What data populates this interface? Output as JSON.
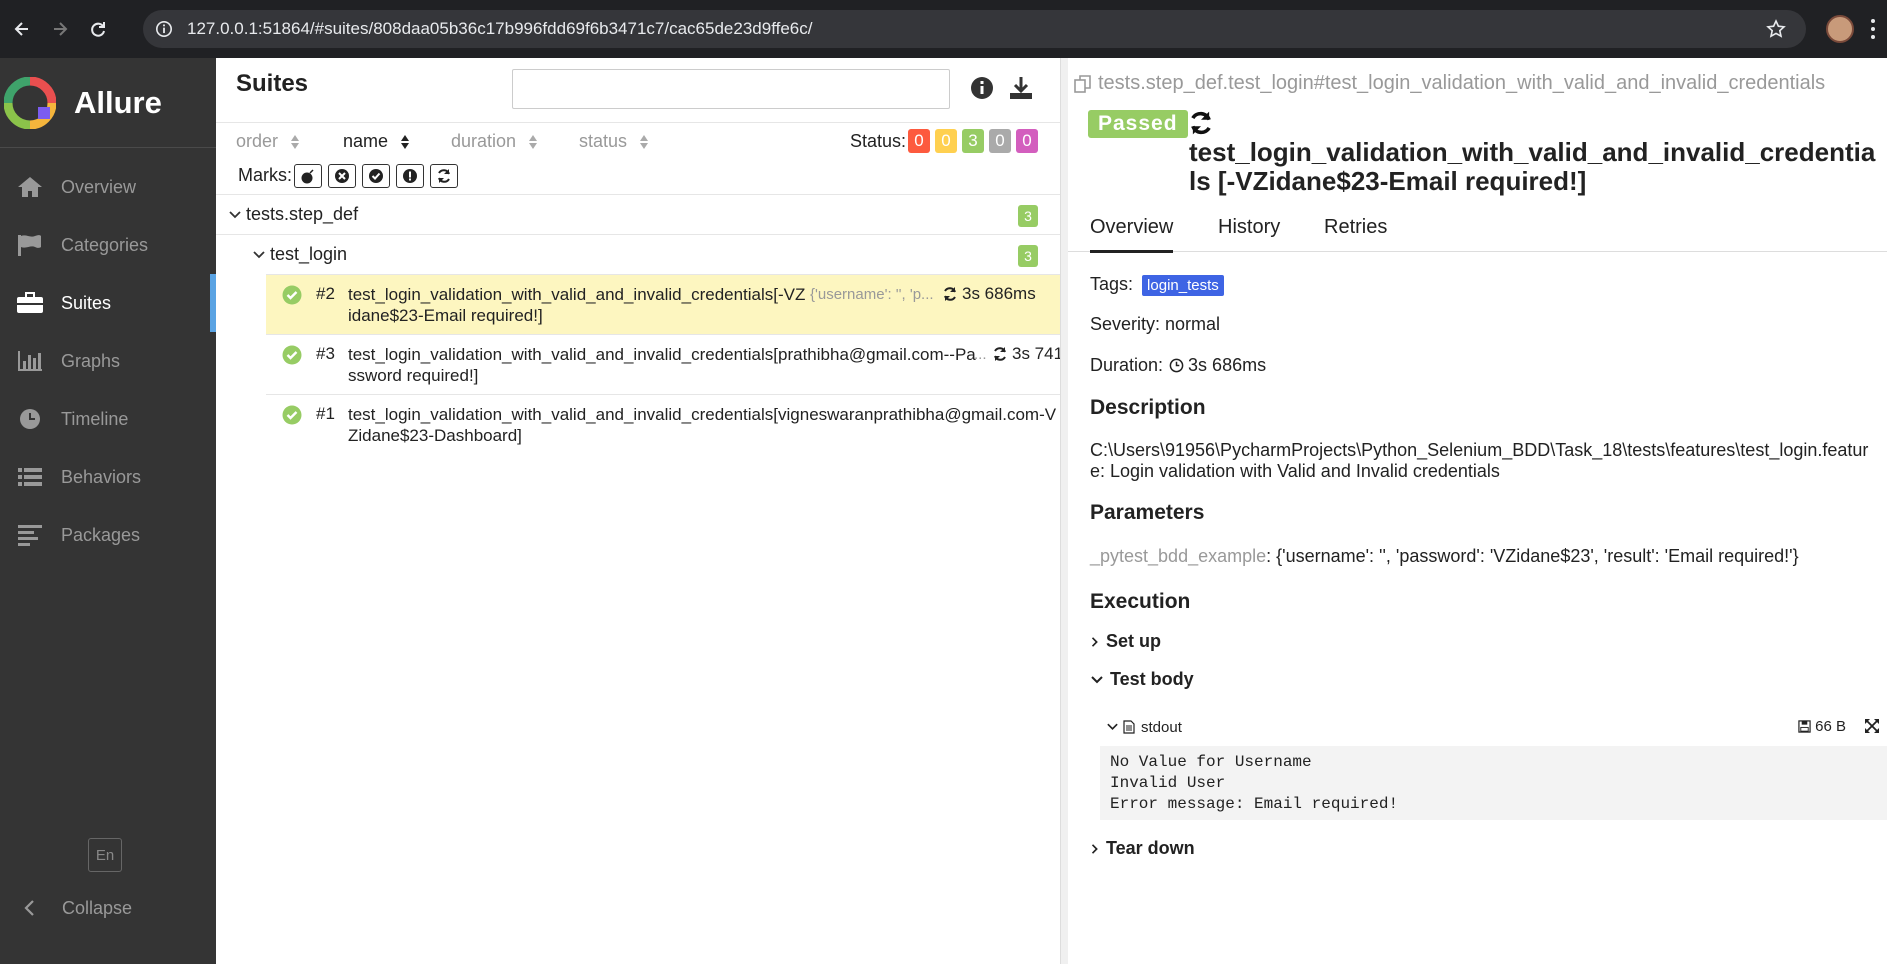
{
  "browser": {
    "url": "127.0.0.1:51864/#suites/808daa05b36c17b996fdd69f6b3471c7/cac65de23d9ffe6c/"
  },
  "sidebar": {
    "brand": "Allure",
    "items": [
      {
        "label": "Overview",
        "icon": "home-icon"
      },
      {
        "label": "Categories",
        "icon": "flag-icon"
      },
      {
        "label": "Suites",
        "icon": "briefcase-icon"
      },
      {
        "label": "Graphs",
        "icon": "bar-chart-icon"
      },
      {
        "label": "Timeline",
        "icon": "clock-icon"
      },
      {
        "label": "Behaviors",
        "icon": "list-icon"
      },
      {
        "label": "Packages",
        "icon": "align-left-icon"
      }
    ],
    "active": "Suites",
    "lang": "En",
    "collapse": "Collapse"
  },
  "suites": {
    "title": "Suites",
    "sort": {
      "order": "order",
      "name": "name",
      "duration": "duration",
      "status": "status"
    },
    "status_label": "Status:",
    "status_counts": [
      {
        "value": "0",
        "color": "#fd5a3e"
      },
      {
        "value": "0",
        "color": "#ffd050"
      },
      {
        "value": "3",
        "color": "#97cc64"
      },
      {
        "value": "0",
        "color": "#aaaaaa"
      },
      {
        "value": "0",
        "color": "#d35ebe"
      }
    ],
    "marks_label": "Marks:",
    "group": {
      "label": "tests.step_def",
      "count": "3"
    },
    "subgroup": {
      "label": "test_login",
      "count": "3"
    },
    "tests": [
      {
        "order": "#2",
        "name": "test_login_validation_with_valid_and_invalid_credentials[-VZidane$23-Email required!]",
        "param": "{'username': '', 'p...",
        "duration": "3s 686ms"
      },
      {
        "order": "#3",
        "name": "test_login_validation_with_valid_and_invalid_credentials[prathibha@gmail.com--Password required!]",
        "param": "...",
        "duration": "3s 741"
      },
      {
        "order": "#1",
        "name": "test_login_validation_with_valid_and_invalid_credentials[vigneswaranprathibha@gmail.com-VZidane$23-Dashboard]",
        "param": "",
        "duration": ""
      }
    ]
  },
  "detail": {
    "path": "tests.step_def.test_login#test_login_validation_with_valid_and_invalid_credentials",
    "status": "Passed",
    "title": "test_login_validation_with_valid_and_invalid_credentials [-VZidane$23-Email required!]",
    "tabs": [
      "Overview",
      "History",
      "Retries"
    ],
    "tags_label": "Tags:",
    "tag": "login_tests",
    "severity": "Severity: normal",
    "duration_label": "Duration:",
    "duration": "3s 686ms",
    "description_heading": "Description",
    "description": "C:\\Users\\91956\\PycharmProjects\\Python_Selenium_BDD\\Task_18\\tests\\features\\test_login.feature: Login validation with Valid and Invalid credentials",
    "parameters_heading": "Parameters",
    "param_key": "_pytest_bdd_example",
    "param_value": ": {'username': '', 'password': 'VZidane$23', 'result': 'Email required!'}",
    "execution_heading": "Execution",
    "setup": "Set up",
    "test_body": "Test body",
    "attachment": "stdout",
    "attachment_size": "66 B",
    "stdout": "No Value for Username\nInvalid User\nError message: Email required!",
    "teardown": "Tear down"
  }
}
